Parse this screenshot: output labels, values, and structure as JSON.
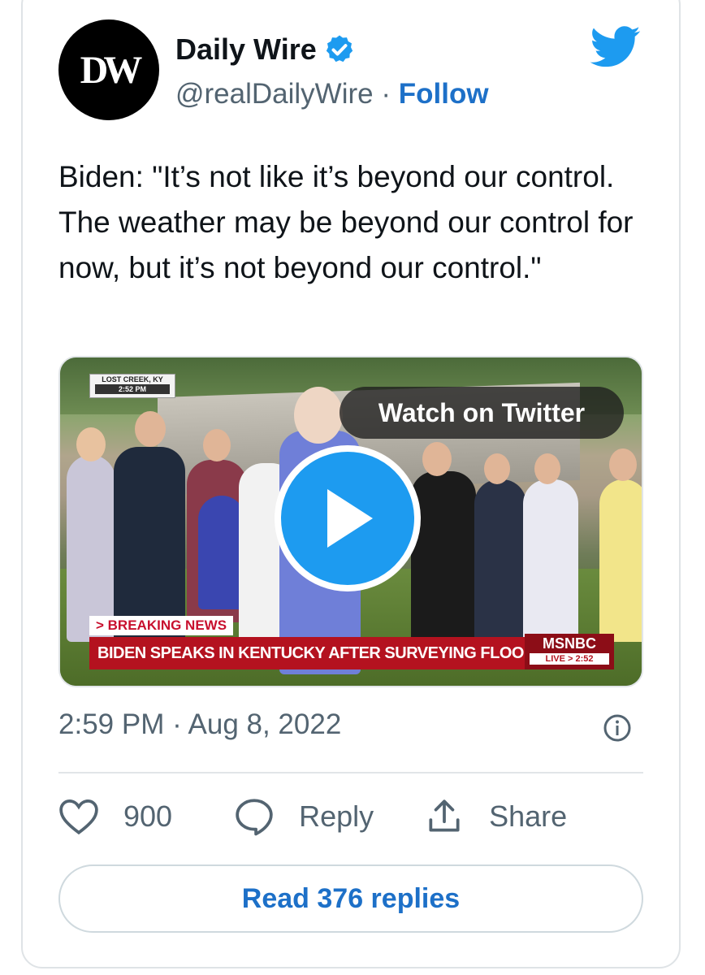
{
  "account": {
    "avatar_text": "DW",
    "name": "Daily Wire",
    "handle": "@realDailyWire",
    "separator": "·",
    "follow_label": "Follow"
  },
  "tweet": {
    "text": "Biden: \"It’s not like it’s beyond our control. The weather may be beyond our control for now, but it’s not beyond our control.\"",
    "timestamp": "2:59 PM · Aug 8, 2022"
  },
  "video": {
    "watch_label": "Watch on Twitter",
    "location": "LOST CREEK, KY",
    "location_time": "2:52 PM",
    "breaking_label": "> BREAKING NEWS",
    "headline": "BIDEN SPEAKS IN KENTUCKY AFTER SURVEYING FLOOD DAMAGE",
    "network": "MSNBC",
    "live_label": "LIVE > 2:52"
  },
  "actions": {
    "likes": "900",
    "reply_label": "Reply",
    "share_label": "Share"
  },
  "footer": {
    "read_replies_label": "Read 376 replies"
  },
  "colors": {
    "brand_blue": "#1d9bf0",
    "link_blue": "#1d70c8",
    "muted": "#536471",
    "breaking_red": "#b4121f"
  }
}
